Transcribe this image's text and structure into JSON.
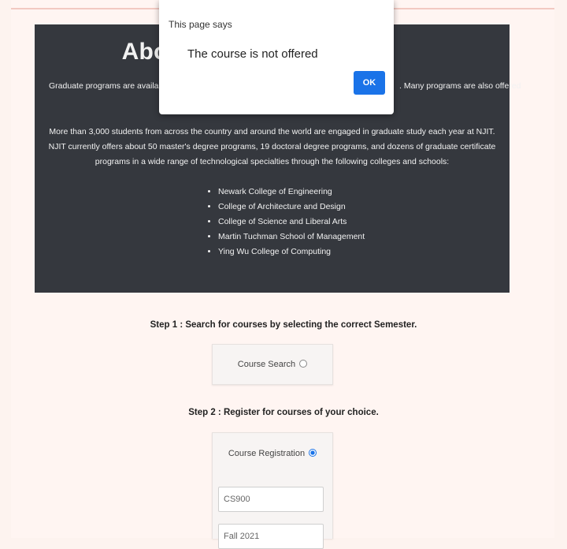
{
  "about": {
    "title": "Abou",
    "intro_left": "Graduate programs are available to f",
    "intro_right": ". Many programs are also offered",
    "paragraph": "More than 3,000 students from across the country and around the world are engaged in graduate study each year at NJIT. NJIT currently offers about 50 master's degree programs, 19 doctoral degree programs, and dozens of graduate certificate programs in a wide range of technological specialties through the following colleges and schools:",
    "schools": [
      "Newark College of Engineering",
      "College of Architecture and Design",
      "College of Science and Liberal Arts",
      "Martin Tuchman School of Management",
      "Ying Wu College of Computing"
    ]
  },
  "steps": {
    "step1": "Step 1 : Search for courses by selecting the correct Semester.",
    "step2": "Step 2 : Register for courses of your choice."
  },
  "options": {
    "course_search_label": "Course Search",
    "course_search_checked": false,
    "course_registration_label": "Course Registration",
    "course_registration_checked": true
  },
  "form": {
    "course_value": "CS900",
    "semester_value": "Fall 2021"
  },
  "dialog": {
    "title": "This page says",
    "message": "The course is not offered",
    "ok_label": "OK"
  },
  "colors": {
    "panel_bg": "#35383e",
    "accent": "#1a73e8",
    "page_bg": "#fdf3ef"
  }
}
